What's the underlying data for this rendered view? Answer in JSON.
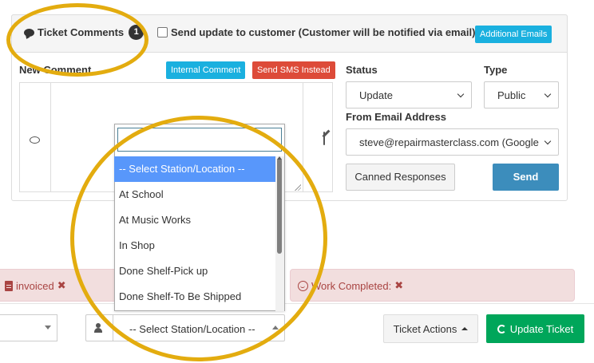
{
  "ticket_comments": {
    "title": "Ticket Comments",
    "count": "1",
    "send_update_label": "Send update to customer (Customer will be notified via email)",
    "additional_emails_label": "Additional Emails"
  },
  "new_comment": {
    "label": "New Comment",
    "internal_comment_label": "Internal Comment",
    "send_sms_label": "Send SMS Instead"
  },
  "status": {
    "label": "Status",
    "value": "Update"
  },
  "type": {
    "label": "Type",
    "value": "Public"
  },
  "from_email": {
    "label": "From Email Address",
    "value": "steve@repairmasterclass.com (Google"
  },
  "canned_responses_label": "Canned Responses",
  "send_label": "Send",
  "alerts": {
    "invoiced": "invoiced",
    "work_completed": "Work Completed:"
  },
  "dropdown": {
    "options": [
      "-- Select Station/Location --",
      "At School",
      "At Music Works",
      "In Shop",
      "Done Shelf-Pick up",
      "Done Shelf-To Be Shipped"
    ],
    "selected_index": 0
  },
  "bottom_bar": {
    "station_select_value": "-- Select Station/Location --",
    "ticket_actions_label": "Ticket Actions",
    "update_ticket_label": "Update Ticket"
  },
  "colors": {
    "annotation_ring": "#e3ac0f",
    "info_button": "#1ab0df",
    "danger_button": "#dd4b39",
    "primary_button": "#3c8dbc",
    "success_button": "#00a65a",
    "selected_option": "#5897fb"
  }
}
